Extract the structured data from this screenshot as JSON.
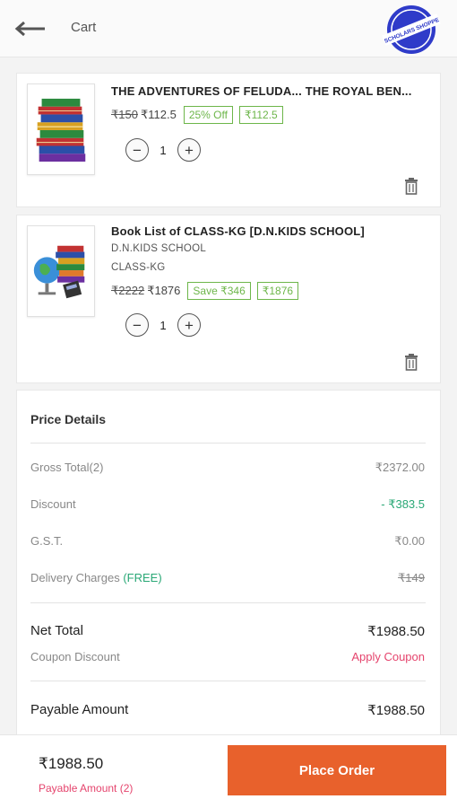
{
  "header": {
    "title": "Cart",
    "back_icon": "arrow-left-icon",
    "logo_text": "SCHOLARS SHOPPE",
    "logo_color": "#2f3bc9"
  },
  "cart_items": [
    {
      "title": "THE ADVENTURES OF FELUDA... THE ROYAL BEN...",
      "subtitle_1": "",
      "subtitle_2": "",
      "mrp": "₹150",
      "price": "₹112.5",
      "badge_1": "25% Off",
      "badge_2": "₹112.5",
      "quantity": "1",
      "minus_label": "−",
      "plus_label": "+",
      "image_icon": "book-stack-icon",
      "delete_icon": "trash-icon"
    },
    {
      "title": "Book List of CLASS-KG [D.N.KIDS SCHOOL]",
      "subtitle_1": "D.N.KIDS SCHOOL",
      "subtitle_2": "CLASS-KG",
      "mrp": "₹2222",
      "price": "₹1876",
      "badge_1": "Save ₹346",
      "badge_2": "₹1876",
      "quantity": "1",
      "minus_label": "−",
      "plus_label": "+",
      "image_icon": "books-globe-icon",
      "delete_icon": "trash-icon"
    }
  ],
  "price_details": {
    "heading": "Price Details",
    "gross_total_label": "Gross Total(2)",
    "gross_total_value": "₹2372.00",
    "discount_label": "Discount",
    "discount_value": "- ₹383.5",
    "gst_label": "G.S.T.",
    "gst_value": "₹0.00",
    "delivery_label": "Delivery Charges",
    "delivery_free": "(FREE)",
    "delivery_value": "₹149",
    "net_total_label": "Net Total",
    "net_total_value": "₹1988.50",
    "coupon_label": "Coupon Discount",
    "coupon_action": "Apply Coupon",
    "payable_label": "Payable Amount",
    "payable_value": "₹1988.50"
  },
  "bottom_bar": {
    "amount": "₹1988.50",
    "label": "Payable Amount (2)",
    "button": "Place Order"
  },
  "colors": {
    "accent": "#e8612c",
    "badge_green": "#6db64a",
    "discount_green": "#2aa876",
    "link_pink": "#e5446d"
  }
}
